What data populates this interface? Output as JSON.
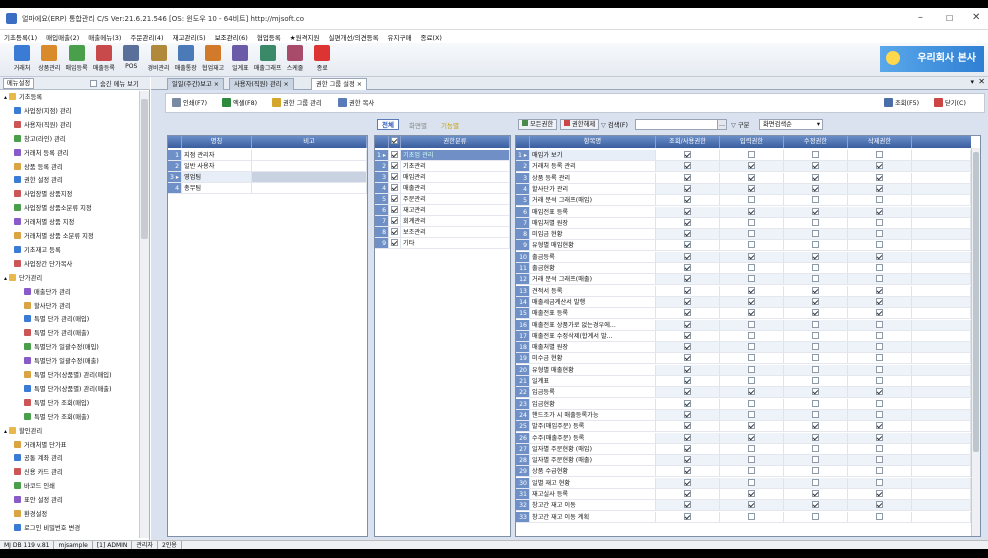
{
  "window": {
    "title": "얼마에요(ERP) 통합관리 C/S  Ver:21.6.21.546  [OS: 윈도우 10 - 64비트]  http://mjsoft.co"
  },
  "menu": [
    "기초등록(1)",
    "매입매출(2)",
    "매출메뉴(3)",
    "주문관리(4)",
    "재고관리(5)",
    "보조관리(6)",
    "협업등록",
    "★원격지원",
    "실편개선/의견등록",
    "유지구매",
    "종료(X)"
  ],
  "toolbar": [
    {
      "label": "거래처",
      "color": "#3a7bd5"
    },
    {
      "label": "상품관리",
      "color": "#d98a2b"
    },
    {
      "label": "매입등록",
      "color": "#4aa04a"
    },
    {
      "label": "매출등록",
      "color": "#c94a4a"
    },
    {
      "label": "POS",
      "color": "#5a6f9a"
    },
    {
      "label": "경비관리",
      "color": "#b08a3a"
    },
    {
      "label": "매출통장",
      "color": "#4a7ab8"
    },
    {
      "label": "협업재고",
      "color": "#d07a2a"
    },
    {
      "label": "일계표",
      "color": "#6a5aa8"
    },
    {
      "label": "매출그래프",
      "color": "#3a8a6a"
    },
    {
      "label": "스케줄",
      "color": "#a84a6a"
    },
    {
      "label": "종료",
      "color": "#d33"
    }
  ],
  "brand": "우리회사 본사",
  "sidebar": {
    "tab": "메뉴설정",
    "checkbox": "숨긴 메뉴 보기"
  },
  "tree": [
    {
      "l": "기초등록",
      "d": 0,
      "f": 1
    },
    {
      "l": "사업장(지점) 관리",
      "d": 1
    },
    {
      "l": "사용자(직원) 관리",
      "d": 1
    },
    {
      "l": "창고(라인) 관리",
      "d": 1
    },
    {
      "l": "거래처 등록 관리",
      "d": 1
    },
    {
      "l": "상품 등록 관리",
      "d": 1
    },
    {
      "l": "권한 설정 관리",
      "d": 1
    },
    {
      "l": "사업장별 상품지정",
      "d": 1
    },
    {
      "l": "사업장별 상품소분류 지정",
      "d": 1
    },
    {
      "l": "거래처별 상품 지정",
      "d": 1
    },
    {
      "l": "거래처별 상품 소분류 지정",
      "d": 1
    },
    {
      "l": "기초재고 등록",
      "d": 1
    },
    {
      "l": "사업장간 단가복사",
      "d": 1
    },
    {
      "l": "단가관리",
      "d": 0,
      "f": 1
    },
    {
      "l": "매출단가 관리",
      "d": 2
    },
    {
      "l": "할사단가 관리",
      "d": 2
    },
    {
      "l": "특별 단가 관리(매입)",
      "d": 2
    },
    {
      "l": "특별 단가 관리(매출)",
      "d": 2
    },
    {
      "l": "특별단가 일괄수정(매입)",
      "d": 2
    },
    {
      "l": "특별단가 일괄수정(매출)",
      "d": 2
    },
    {
      "l": "특별 단가(상품별) 관리(매입)",
      "d": 2
    },
    {
      "l": "특별 단가(상품별) 관리(매출)",
      "d": 2
    },
    {
      "l": "특별 단가 조회(매입)",
      "d": 2
    },
    {
      "l": "특별 단가 조회(매출)",
      "d": 2
    },
    {
      "l": "할인관리",
      "d": 0,
      "f": 1
    },
    {
      "l": "거래처별 단가표",
      "d": 1
    },
    {
      "l": "공통 계좌 관리",
      "d": 1
    },
    {
      "l": "신용 카드 관리",
      "d": 1
    },
    {
      "l": "바코드 인쇄",
      "d": 1
    },
    {
      "l": "표안 설정 관리",
      "d": 1
    },
    {
      "l": "환경설정",
      "d": 1
    },
    {
      "l": "로그인 비밀번호 변경",
      "d": 1
    }
  ],
  "tabs": [
    "일일(주간)보고",
    "사용자(직원) 관리",
    "권한 그룹 설정"
  ],
  "buttons": {
    "print": "인쇄(F7)",
    "excel": "엑셀(F8)",
    "group_mgmt": "권한 그룹 관리",
    "copy": "권한 복사",
    "search": "조회(F5)",
    "close": "닫기(C)"
  },
  "view_tabs": [
    "전체",
    "화면별",
    "기능별"
  ],
  "filter": {
    "all_perm": "모든권한",
    "ok_perm": "권한해제",
    "search_label": "검색(F)",
    "sort_label": "구분",
    "sort_value": "화면검색순"
  },
  "group_grid": {
    "headers": [
      "명칭",
      "비고"
    ],
    "rows": [
      "지점 관리자",
      "일반 사용자",
      "영업팀",
      "총무팀"
    ]
  },
  "cat_grid": {
    "headers": [
      "권한분류"
    ],
    "rows": [
      "기초업 관리",
      "기초관리",
      "매입관리",
      "매출관리",
      "주문관리",
      "재고관리",
      "회계관리",
      "보조관리",
      "기타"
    ]
  },
  "perm_grid": {
    "headers": [
      "항목명",
      "조회/사용권한",
      "입력권한",
      "수정권한",
      "삭제권한"
    ],
    "rows": [
      {
        "n": "매입가 보기",
        "c": [
          1,
          0,
          0,
          0
        ]
      },
      {
        "n": "거래처 등록 관리",
        "c": [
          1,
          1,
          1,
          1
        ]
      },
      {
        "n": "상품 등록 관리",
        "c": [
          1,
          1,
          1,
          1
        ]
      },
      {
        "n": "할사단가 관리",
        "c": [
          1,
          1,
          1,
          1
        ]
      },
      {
        "n": "거래 분석 그래프(매입)",
        "c": [
          1,
          0,
          0,
          0
        ]
      },
      {
        "n": "매입전표 등록",
        "c": [
          1,
          1,
          1,
          1
        ]
      },
      {
        "n": "매입처별 원장",
        "c": [
          1,
          0,
          0,
          0
        ]
      },
      {
        "n": "미입금 현황",
        "c": [
          1,
          0,
          0,
          0
        ]
      },
      {
        "n": "유형별 매입현황",
        "c": [
          1,
          0,
          0,
          0
        ]
      },
      {
        "n": "출금등록",
        "c": [
          1,
          1,
          1,
          1
        ]
      },
      {
        "n": "출금현황",
        "c": [
          1,
          0,
          0,
          0
        ]
      },
      {
        "n": "거래 분석 그래프(매출)",
        "c": [
          1,
          0,
          0,
          0
        ]
      },
      {
        "n": "견적서 등록",
        "c": [
          1,
          1,
          1,
          1
        ]
      },
      {
        "n": "매출세금계산서 발행",
        "c": [
          1,
          1,
          1,
          1
        ]
      },
      {
        "n": "매출전표 등록",
        "c": [
          1,
          1,
          1,
          1
        ]
      },
      {
        "n": "매출전표 상품가로 없는경우에...",
        "c": [
          1,
          0,
          0,
          0
        ]
      },
      {
        "n": "매출전표 수정삭제(합계서 발...",
        "c": [
          1,
          0,
          0,
          0
        ]
      },
      {
        "n": "매출처별 원장",
        "c": [
          1,
          0,
          0,
          0
        ]
      },
      {
        "n": "미수금 현황",
        "c": [
          1,
          0,
          0,
          0
        ]
      },
      {
        "n": "유형별 매출현황",
        "c": [
          1,
          0,
          0,
          0
        ]
      },
      {
        "n": "일계표",
        "c": [
          1,
          0,
          0,
          0
        ]
      },
      {
        "n": "입금등록",
        "c": [
          1,
          1,
          1,
          1
        ]
      },
      {
        "n": "입금현황",
        "c": [
          1,
          0,
          0,
          0
        ]
      },
      {
        "n": "핸드조가 시 매출등록가능",
        "c": [
          1,
          0,
          0,
          0
        ]
      },
      {
        "n": "발주(매입주문) 등록",
        "c": [
          1,
          1,
          1,
          1
        ]
      },
      {
        "n": "수주(매출주문) 등록",
        "c": [
          1,
          1,
          1,
          1
        ]
      },
      {
        "n": "일자별 주문현황 (매입)",
        "c": [
          1,
          0,
          0,
          0
        ]
      },
      {
        "n": "일자별 주문현황 (매출)",
        "c": [
          1,
          0,
          0,
          0
        ]
      },
      {
        "n": "상품 수급현황",
        "c": [
          1,
          0,
          0,
          0
        ]
      },
      {
        "n": "일별 재고 현황",
        "c": [
          1,
          0,
          0,
          0
        ]
      },
      {
        "n": "재고실사 등록",
        "c": [
          1,
          1,
          1,
          1
        ]
      },
      {
        "n": "창고간 재고 이동",
        "c": [
          1,
          1,
          1,
          1
        ]
      },
      {
        "n": "창고간 재고 이동 계획",
        "c": [
          1,
          0,
          0,
          0
        ]
      }
    ]
  },
  "status": [
    "MJ DB 119 v.81",
    "mjsample",
    "[1] ADMIN",
    "관리자",
    "2인용"
  ]
}
